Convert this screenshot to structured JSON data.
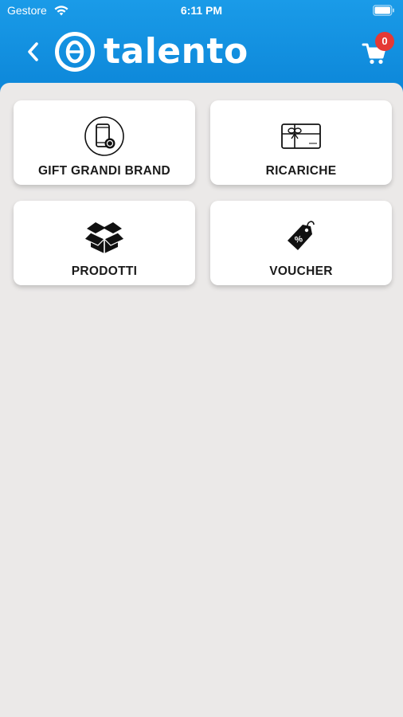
{
  "status_bar": {
    "carrier": "Gestore",
    "time": "6:11 PM"
  },
  "header": {
    "logo_text": "talento",
    "cart_count": "0",
    "colors": {
      "header_bg": "#0c86d8",
      "badge": "#e53935"
    }
  },
  "menu": {
    "items": [
      {
        "label": "GIFT GRANDI BRAND",
        "icon": "phone-gift-icon"
      },
      {
        "label": "RICARICHE",
        "icon": "gift-card-icon"
      },
      {
        "label": "PRODOTTI",
        "icon": "open-box-icon"
      },
      {
        "label": "VOUCHER",
        "icon": "discount-tag-icon"
      }
    ]
  }
}
